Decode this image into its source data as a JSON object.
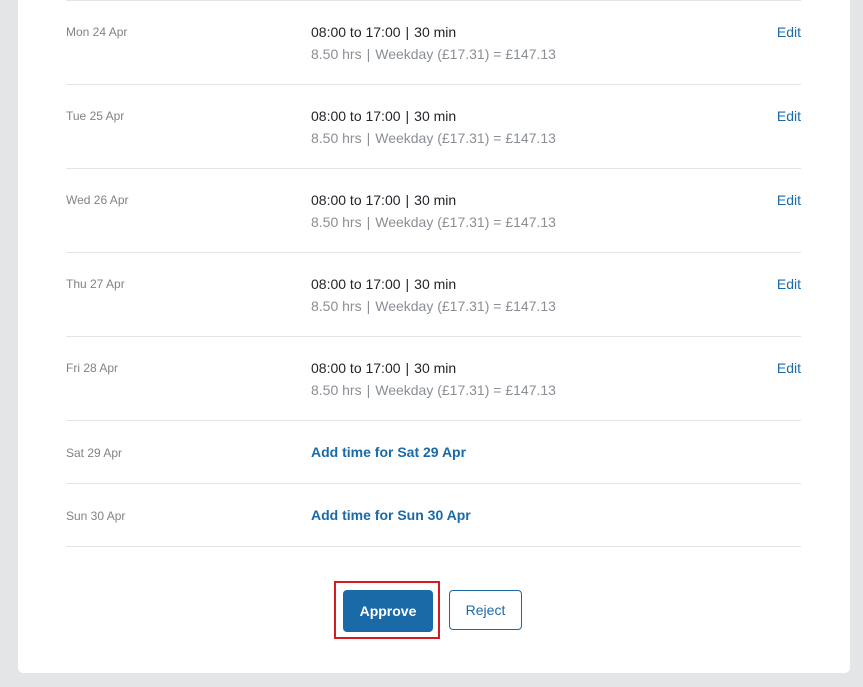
{
  "timesheet": {
    "days": [
      {
        "date": "Mon 24 Apr",
        "time": "08:00 to 17:00",
        "break": "30 min",
        "hours": "8.50 hrs",
        "rate": "Weekday (£17.31) = £147.13",
        "edit": "Edit"
      },
      {
        "date": "Tue 25 Apr",
        "time": "08:00 to 17:00",
        "break": "30 min",
        "hours": "8.50 hrs",
        "rate": "Weekday (£17.31) = £147.13",
        "edit": "Edit"
      },
      {
        "date": "Wed 26 Apr",
        "time": "08:00 to 17:00",
        "break": "30 min",
        "hours": "8.50 hrs",
        "rate": "Weekday (£17.31) = £147.13",
        "edit": "Edit"
      },
      {
        "date": "Thu 27 Apr",
        "time": "08:00 to 17:00",
        "break": "30 min",
        "hours": "8.50 hrs",
        "rate": "Weekday (£17.31) = £147.13",
        "edit": "Edit"
      },
      {
        "date": "Fri 28 Apr",
        "time": "08:00 to 17:00",
        "break": "30 min",
        "hours": "8.50 hrs",
        "rate": "Weekday (£17.31) = £147.13",
        "edit": "Edit"
      }
    ],
    "empty_days": [
      {
        "date": "Sat 29 Apr",
        "add": "Add time for Sat 29 Apr"
      },
      {
        "date": "Sun 30 Apr",
        "add": "Add time for Sun 30 Apr"
      }
    ],
    "separator": "|"
  },
  "actions": {
    "approve": "Approve",
    "reject": "Reject"
  },
  "colors": {
    "accent": "#1a6aa8",
    "highlight": "#d71920"
  }
}
